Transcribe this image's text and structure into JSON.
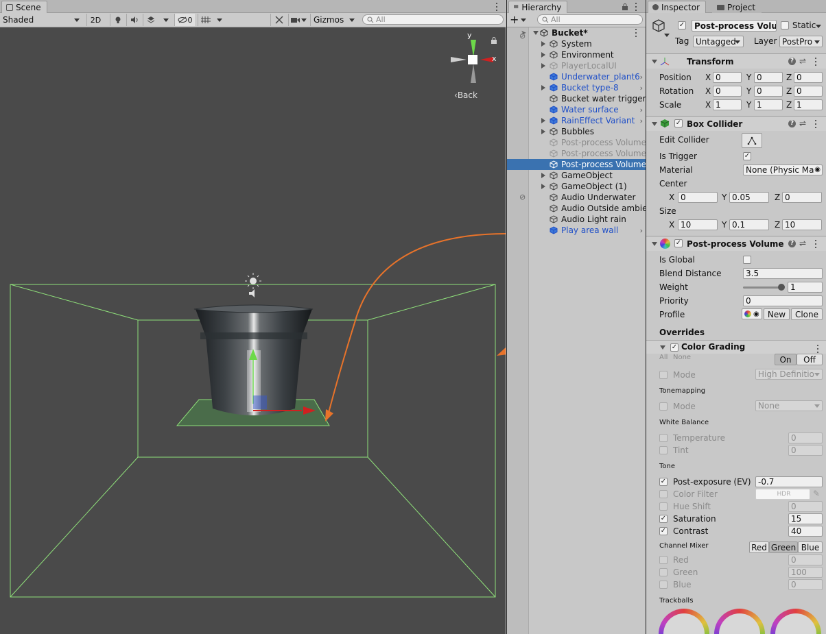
{
  "scene": {
    "tab_label": "Scene",
    "shading_mode": "Shaded",
    "btn_2d": "2D",
    "hidden_count": "0",
    "gizmos_label": "Gizmos",
    "search_placeholder": "All",
    "view_label": "Back",
    "axis_y": "y",
    "axis_x": "x"
  },
  "hierarchy": {
    "tab_label": "Hierarchy",
    "search_placeholder": "All",
    "root": "Bucket*",
    "items": [
      {
        "label": "System"
      },
      {
        "label": "Environment"
      },
      {
        "label": "PlayerLocalUI"
      },
      {
        "label": "Underwater_plant6"
      },
      {
        "label": "Bucket type-8"
      },
      {
        "label": "Bucket water trigger"
      },
      {
        "label": "Water surface"
      },
      {
        "label": "RainEffect Variant"
      },
      {
        "label": "Bubbles"
      },
      {
        "label": "Post-process Volume"
      },
      {
        "label": "Post-process Volume"
      },
      {
        "label": "Post-process Volume"
      },
      {
        "label": "GameObject"
      },
      {
        "label": "GameObject (1)"
      },
      {
        "label": "Audio Underwater"
      },
      {
        "label": "Audio Outside ambien"
      },
      {
        "label": "Audio Light rain"
      },
      {
        "label": "Play area wall"
      }
    ]
  },
  "inspector": {
    "tab_inspector": "Inspector",
    "tab_project": "Project",
    "object_name": "Post-process Volum",
    "static_label": "Static",
    "tag_label": "Tag",
    "tag_value": "Untagged",
    "layer_label": "Layer",
    "layer_value": "PostPro",
    "transform": {
      "title": "Transform",
      "position_label": "Position",
      "rotation_label": "Rotation",
      "scale_label": "Scale",
      "position": {
        "x": "0",
        "y": "0",
        "z": "0"
      },
      "rotation": {
        "x": "0",
        "y": "0",
        "z": "0"
      },
      "scale": {
        "x": "1",
        "y": "1",
        "z": "1"
      }
    },
    "box_collider": {
      "title": "Box Collider",
      "edit_collider_label": "Edit Collider",
      "is_trigger_label": "Is Trigger",
      "material_label": "Material",
      "material_value": "None (Physic Ma",
      "center_label": "Center",
      "center": {
        "x": "0",
        "y": "0.05",
        "z": "0"
      },
      "size_label": "Size",
      "size": {
        "x": "10",
        "y": "0.1",
        "z": "10"
      }
    },
    "ppv": {
      "title": "Post-process Volume",
      "is_global_label": "Is Global",
      "blend_distance_label": "Blend Distance",
      "blend_distance": "3.5",
      "weight_label": "Weight",
      "weight": "1",
      "priority_label": "Priority",
      "priority": "0",
      "profile_label": "Profile",
      "new_btn": "New",
      "clone_btn": "Clone",
      "overrides_label": "Overrides"
    },
    "color_grading": {
      "title": "Color Grading",
      "all": "All",
      "none": "None",
      "on": "On",
      "off": "Off",
      "mode_label": "Mode",
      "mode_value": "High Definitio",
      "tonemapping_label": "Tonemapping",
      "tm_mode_label": "Mode",
      "tm_mode_value": "None",
      "white_balance_label": "White Balance",
      "temperature_label": "Temperature",
      "temperature": "0",
      "tint_label": "Tint",
      "tint": "0",
      "tone_label": "Tone",
      "post_exposure_label": "Post-exposure (EV)",
      "post_exposure": "-0.7",
      "color_filter_label": "Color Filter",
      "hdr": "HDR",
      "hue_shift_label": "Hue Shift",
      "hue_shift": "0",
      "saturation_label": "Saturation",
      "saturation": "15",
      "contrast_label": "Contrast",
      "contrast": "40",
      "channel_mixer_label": "Channel Mixer",
      "cm_red_btn": "Red",
      "cm_green_btn": "Green",
      "cm_blue_btn": "Blue",
      "red_label": "Red",
      "red": "0",
      "green_label": "Green",
      "green": "100",
      "blue_label": "Blue",
      "blue": "0",
      "trackballs_label": "Trackballs"
    }
  },
  "colors": {
    "selection": "#3a72b0",
    "prefab_text": "#1f4fc7",
    "annotation_arrow": "#e8732a",
    "collider_wire": "#8fe07a",
    "scene_bg": "#4a4a4a"
  }
}
